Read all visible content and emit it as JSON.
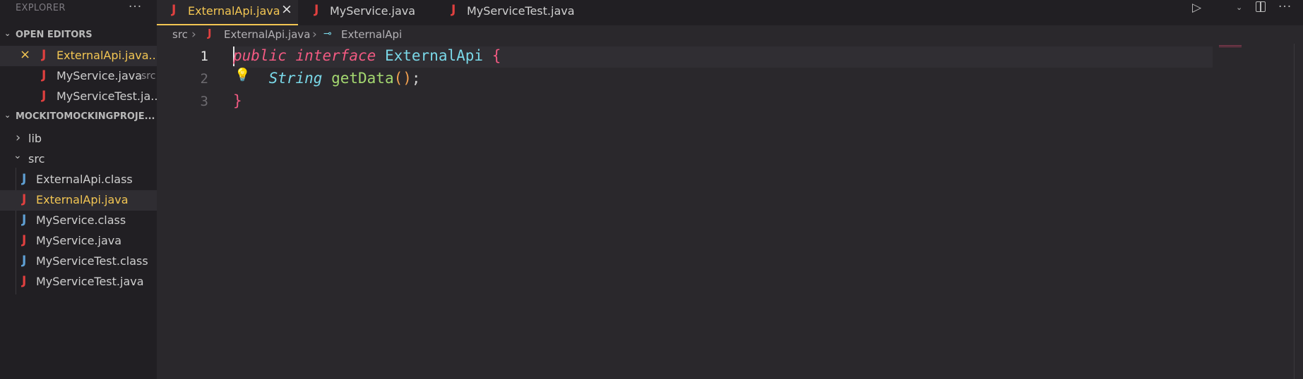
{
  "sidebar": {
    "title": "EXPLORER",
    "more": "···",
    "open_editors": {
      "label": "OPEN EDITORS",
      "items": [
        {
          "name": "ExternalApi.java...",
          "hint": ""
        },
        {
          "name": "MyService.java",
          "hint": "src"
        },
        {
          "name": "MyServiceTest.ja...",
          "hint": ""
        }
      ]
    },
    "project": {
      "label": "MOCKITOMOCKINGPROJE...",
      "folders": [
        "lib",
        "src"
      ],
      "files": [
        {
          "name": "ExternalApi.class",
          "kind": "class"
        },
        {
          "name": "ExternalApi.java",
          "kind": "java"
        },
        {
          "name": "MyService.class",
          "kind": "class"
        },
        {
          "name": "MyService.java",
          "kind": "java"
        },
        {
          "name": "MyServiceTest.class",
          "kind": "class"
        },
        {
          "name": "MyServiceTest.java",
          "kind": "java"
        }
      ]
    }
  },
  "tabs": [
    {
      "label": "ExternalApi.java",
      "active": true
    },
    {
      "label": "MyService.java",
      "active": false
    },
    {
      "label": "MyServiceTest.java",
      "active": false
    }
  ],
  "toolbar": {
    "run_icon": "play-icon",
    "split_icon": "split-editor-icon",
    "more": "···"
  },
  "breadcrumb": {
    "folder": "src",
    "file": "ExternalApi.java",
    "symbol": "ExternalApi"
  },
  "editor": {
    "line_numbers": [
      "1",
      "2",
      "3"
    ],
    "tokens": {
      "l1_public": "public",
      "l1_interface": "interface",
      "l1_name": "ExternalApi",
      "l1_brace": "{",
      "l2_type": "String",
      "l2_fn": "getData",
      "l2_parens": "()",
      "l2_semi": ";",
      "l3_brace": "}"
    }
  },
  "icons": {
    "java_icon_glyph": "J",
    "close_glyph": "×",
    "chevron_right": "›",
    "chevron_down": "⌄",
    "bulb": "💡"
  },
  "colors": {
    "accent": "#f3c653",
    "java_red": "#e0403f",
    "class_blue": "#5fa0d4",
    "keyword": "#f25a82",
    "type": "#7ad8e8",
    "function": "#a4d870"
  }
}
